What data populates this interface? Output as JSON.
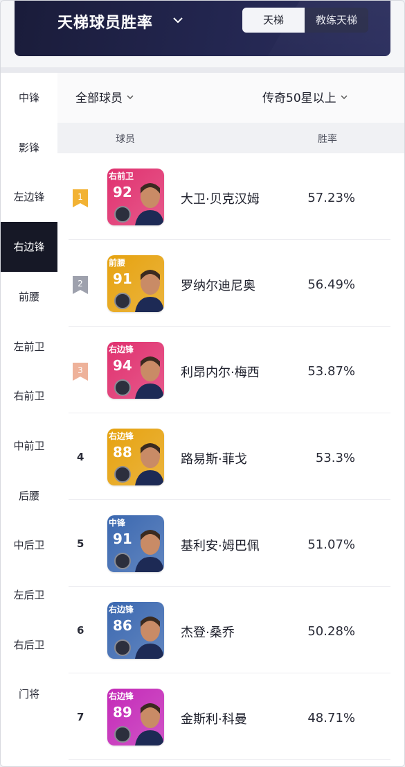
{
  "header": {
    "title": "天梯球员胜率",
    "tabs": [
      {
        "label": "天梯",
        "active": true
      },
      {
        "label": "教练天梯",
        "active": false
      }
    ]
  },
  "filters": {
    "player_filter": "全部球员",
    "level_filter": "传奇50星以上"
  },
  "sidebar": {
    "items": [
      {
        "label": "中锋",
        "active": false
      },
      {
        "label": "影锋",
        "active": false
      },
      {
        "label": "左边锋",
        "active": false
      },
      {
        "label": "右边锋",
        "active": true
      },
      {
        "label": "前腰",
        "active": false
      },
      {
        "label": "左前卫",
        "active": false
      },
      {
        "label": "右前卫",
        "active": false
      },
      {
        "label": "中前卫",
        "active": false
      },
      {
        "label": "后腰",
        "active": false
      },
      {
        "label": "中后卫",
        "active": false
      },
      {
        "label": "左后卫",
        "active": false
      },
      {
        "label": "右后卫",
        "active": false
      },
      {
        "label": "门将",
        "active": false
      }
    ]
  },
  "table": {
    "col_player": "球员",
    "col_rate": "胜率",
    "rows": [
      {
        "rank": "1",
        "position": "右前卫",
        "rating": "92",
        "name": "大卫·贝克汉姆",
        "rate": "57.23%",
        "card_color": "#e0316f",
        "rank_color": "#f2b233"
      },
      {
        "rank": "2",
        "position": "前腰",
        "rating": "91",
        "name": "罗纳尔迪尼奥",
        "rate": "56.49%",
        "card_color": "#e6a20f",
        "rank_color": "#9ea1ad"
      },
      {
        "rank": "3",
        "position": "右边锋",
        "rating": "94",
        "name": "利昂内尔·梅西",
        "rate": "53.87%",
        "card_color": "#e0316f",
        "rank_color": "#eeb29a"
      },
      {
        "rank": "4",
        "position": "右边锋",
        "rating": "88",
        "name": "路易斯·菲戈",
        "rate": "53.3%",
        "card_color": "#e6a20f",
        "rank_color": ""
      },
      {
        "rank": "5",
        "position": "中锋",
        "rating": "91",
        "name": "基利安·姆巴佩",
        "rate": "51.07%",
        "card_color": "#3b68b0",
        "rank_color": ""
      },
      {
        "rank": "6",
        "position": "右边锋",
        "rating": "86",
        "name": "杰登·桑乔",
        "rate": "50.28%",
        "card_color": "#3b68b0",
        "rank_color": ""
      },
      {
        "rank": "7",
        "position": "右边锋",
        "rating": "89",
        "name": "金斯利·科曼",
        "rate": "48.71%",
        "card_color": "#c42ab8",
        "rank_color": ""
      }
    ]
  }
}
